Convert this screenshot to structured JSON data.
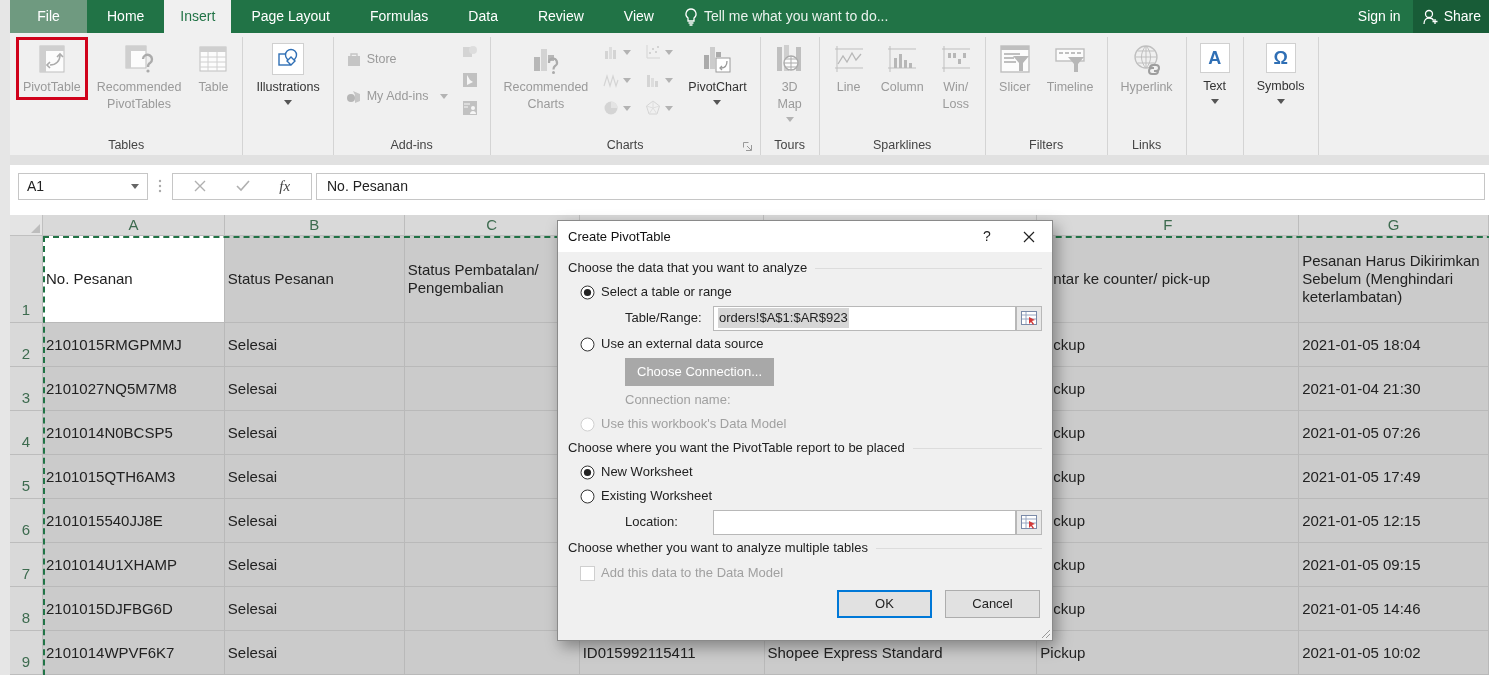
{
  "tabs": [
    {
      "label": "File",
      "kind": "file",
      "selected": false
    },
    {
      "label": "Home",
      "kind": "tab",
      "selected": false
    },
    {
      "label": "Insert",
      "kind": "tab",
      "selected": true
    },
    {
      "label": "Page Layout",
      "kind": "tab",
      "selected": false
    },
    {
      "label": "Formulas",
      "kind": "tab",
      "selected": false
    },
    {
      "label": "Data",
      "kind": "tab",
      "selected": false
    },
    {
      "label": "Review",
      "kind": "tab",
      "selected": false
    },
    {
      "label": "View",
      "kind": "tab",
      "selected": false
    }
  ],
  "tell_me": "Tell me what you want to do...",
  "sign_in": "Sign in",
  "share": "Share",
  "ribbon": [
    {
      "label": "Tables",
      "columns": [
        [
          {
            "kind": "large",
            "lines": [
              "PivotTable"
            ],
            "disabled": true,
            "highlighted": true
          }
        ],
        [
          {
            "kind": "large",
            "lines": [
              "Recommended",
              "PivotTables"
            ],
            "disabled": true
          }
        ],
        [
          {
            "kind": "large",
            "lines": [
              "Table"
            ],
            "disabled": true
          }
        ]
      ]
    },
    {
      "columns": [
        [
          {
            "kind": "large",
            "lines": [
              "Illustrations"
            ],
            "disabled": false,
            "dropdown": true
          }
        ]
      ]
    },
    {
      "label": "Add-ins",
      "columns": [
        [
          {
            "kind": "small",
            "lines": [
              "Store"
            ],
            "disabled": true
          },
          {
            "kind": "small",
            "lines": [
              "My Add-ins"
            ],
            "disabled": true,
            "dropdown": true
          }
        ],
        [
          {
            "kind": "icon",
            "disabled": true
          },
          {
            "kind": "icon",
            "disabled": true
          },
          {
            "kind": "icon",
            "disabled": true
          }
        ]
      ]
    },
    {
      "label": "Charts",
      "launcher": true,
      "columns": [
        [
          {
            "kind": "large",
            "lines": [
              "Recommended",
              "Charts"
            ],
            "disabled": true
          }
        ],
        [
          {
            "kind": "icon",
            "disabled": true,
            "dropdown": true
          },
          {
            "kind": "icon",
            "disabled": true,
            "dropdown": true
          },
          {
            "kind": "icon",
            "disabled": true,
            "dropdown": true
          }
        ],
        [
          {
            "kind": "icon",
            "disabled": true,
            "dropdown": true
          },
          {
            "kind": "icon",
            "disabled": true,
            "dropdown": true
          },
          {
            "kind": "icon",
            "disabled": true,
            "dropdown": true
          }
        ],
        [
          {
            "kind": "large",
            "lines": [
              "PivotChart"
            ],
            "disabled": false,
            "dropdown": true
          }
        ]
      ]
    },
    {
      "label": "Tours",
      "columns": [
        [
          {
            "kind": "large",
            "lines": [
              "3D",
              "Map"
            ],
            "disabled": true,
            "dropdown": true
          }
        ]
      ]
    },
    {
      "label": "Sparklines",
      "columns": [
        [
          {
            "kind": "large",
            "lines": [
              "Line"
            ],
            "disabled": true
          }
        ],
        [
          {
            "kind": "large",
            "lines": [
              "Column"
            ],
            "disabled": true
          }
        ],
        [
          {
            "kind": "large",
            "lines": [
              "Win/",
              "Loss"
            ],
            "disabled": true
          }
        ]
      ]
    },
    {
      "label": "Filters",
      "columns": [
        [
          {
            "kind": "large",
            "lines": [
              "Slicer"
            ],
            "disabled": true
          }
        ],
        [
          {
            "kind": "large",
            "lines": [
              "Timeline"
            ],
            "disabled": true
          }
        ]
      ]
    },
    {
      "label": "Links",
      "columns": [
        [
          {
            "kind": "large",
            "lines": [
              "Hyperlink"
            ],
            "disabled": true
          }
        ]
      ]
    },
    {
      "columns": [
        [
          {
            "kind": "large",
            "lines": [
              "Text"
            ],
            "glyph": "A",
            "disabled": false,
            "dropdown": true
          }
        ]
      ]
    },
    {
      "columns": [
        [
          {
            "kind": "large",
            "lines": [
              "Symbols"
            ],
            "glyph": "Ω",
            "disabled": false,
            "dropdown": true
          }
        ]
      ]
    }
  ],
  "name_box": "A1",
  "function_button": "fx",
  "formula": "No. Pesanan",
  "column_headers": [
    {
      "label": "A"
    },
    {
      "label": "B"
    },
    {
      "label": "C"
    },
    {
      "label": "F"
    },
    {
      "label": "G"
    }
  ],
  "rows": [
    {
      "number": "1",
      "cells": [
        {
          "text": "No. Pesanan",
          "active": true
        },
        {
          "text": "Status Pesanan"
        },
        {
          "text": "Status Pembatalan/ Pengembalian"
        },
        {},
        {},
        {
          "text": "ntar ke counter/ pick-up"
        },
        {
          "text": "Pesanan Harus Dikirimkan Sebelum (Menghindari keterlambatan)"
        }
      ]
    },
    {
      "number": "2",
      "cells": [
        {
          "text": "2101015RMGPMMJ"
        },
        {
          "text": "Selesai"
        },
        {},
        {},
        {},
        {
          "text": "ckup"
        },
        {
          "text": "2021-01-05 18:04"
        }
      ]
    },
    {
      "number": "3",
      "cells": [
        {
          "text": "2101027NQ5M7M8"
        },
        {
          "text": "Selesai"
        },
        {},
        {},
        {},
        {
          "text": "ckup"
        },
        {
          "text": "2021-01-04 21:30"
        }
      ]
    },
    {
      "number": "4",
      "cells": [
        {
          "text": "2101014N0BCSP5"
        },
        {
          "text": "Selesai"
        },
        {},
        {},
        {},
        {
          "text": "ckup"
        },
        {
          "text": "2021-01-05 07:26"
        }
      ]
    },
    {
      "number": "5",
      "cells": [
        {
          "text": "2101015QTH6AM3"
        },
        {
          "text": "Selesai"
        },
        {},
        {},
        {},
        {
          "text": "ckup"
        },
        {
          "text": "2021-01-05 17:49"
        }
      ]
    },
    {
      "number": "6",
      "cells": [
        {
          "text": "2101015540JJ8E"
        },
        {
          "text": "Selesai"
        },
        {},
        {},
        {},
        {
          "text": "ckup"
        },
        {
          "text": "2021-01-05 12:15"
        }
      ]
    },
    {
      "number": "7",
      "cells": [
        {
          "text": "2101014U1XHAMP"
        },
        {
          "text": "Selesai"
        },
        {},
        {},
        {},
        {
          "text": "ckup"
        },
        {
          "text": "2021-01-05 09:15"
        }
      ]
    },
    {
      "number": "8",
      "cells": [
        {
          "text": "2101015DJFBG6D"
        },
        {
          "text": "Selesai"
        },
        {},
        {},
        {},
        {
          "text": "ckup"
        },
        {
          "text": "2021-01-05 14:46"
        }
      ]
    },
    {
      "number": "9",
      "cells": [
        {
          "text": "2101014WPVF6K7"
        },
        {
          "text": "Selesai"
        },
        {},
        {
          "text": "ID015992115411"
        },
        {
          "text": "Shopee Express Standard"
        },
        {
          "text": "Pickup"
        },
        {
          "text": "2021-01-05 10:02"
        }
      ]
    }
  ],
  "dialog": {
    "title": "Create PivotTable",
    "help": "?",
    "sections": [
      {
        "heading": "Choose the data that you want to analyze",
        "rows": [
          {
            "kind": "radio",
            "label": "Select a table or range",
            "selected": true,
            "disabled": false
          },
          {
            "kind": "field",
            "label": "Table/Range:",
            "value": "orders!$A$1:$AR$923"
          },
          {
            "kind": "radio",
            "label": "Use an external data source",
            "selected": false,
            "disabled": false
          },
          {
            "kind": "button",
            "label": "Choose Connection...",
            "disabled": true
          },
          {
            "kind": "note",
            "label": "Connection name:",
            "disabled": true
          },
          {
            "kind": "radio",
            "label": "Use this workbook's Data Model",
            "selected": false,
            "disabled": true
          }
        ]
      },
      {
        "heading": "Choose where you want the PivotTable report to be placed",
        "rows": [
          {
            "kind": "radio",
            "label": "New Worksheet",
            "selected": true,
            "disabled": false
          },
          {
            "kind": "radio",
            "label": "Existing Worksheet",
            "selected": false,
            "disabled": false
          },
          {
            "kind": "field",
            "label": "Location:"
          }
        ]
      },
      {
        "heading": "Choose whether you want to analyze multiple tables",
        "rows": [
          {
            "kind": "checkbox",
            "label": "Add this data to the Data Model",
            "checked": false,
            "disabled": true
          }
        ]
      }
    ],
    "buttons": [
      {
        "label": "OK",
        "default": true
      },
      {
        "label": "Cancel",
        "default": false
      }
    ]
  }
}
